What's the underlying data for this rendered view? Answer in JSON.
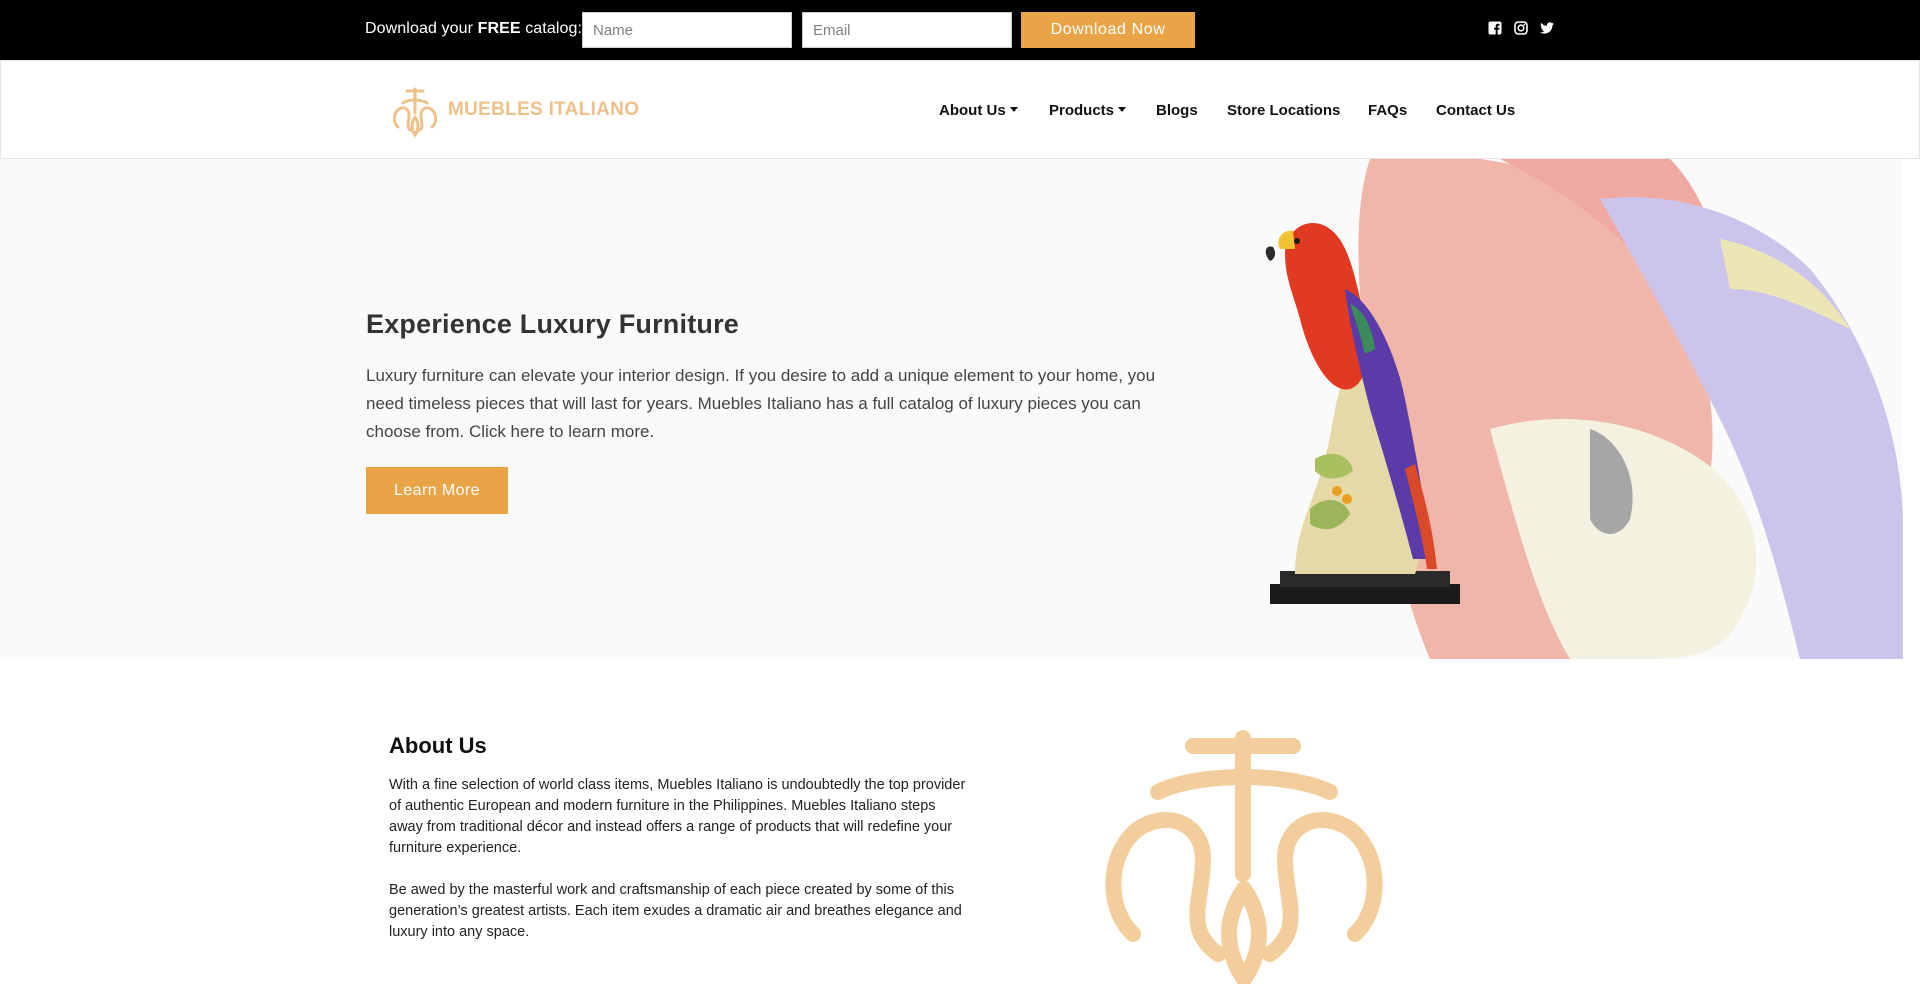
{
  "topbar": {
    "catalog_prefix": "Download your ",
    "catalog_free": "FREE",
    "catalog_suffix": " catalog:",
    "name_placeholder": "Name",
    "email_placeholder": "Email",
    "download_label": "Download Now",
    "social_icons": [
      "facebook-icon",
      "instagram-icon",
      "twitter-icon"
    ]
  },
  "header": {
    "logo_text": "MUEBLES ITALIANO",
    "nav": {
      "about": "About Us",
      "products": "Products",
      "blogs": "Blogs",
      "stores": "Store Locations",
      "faqs": "FAQs",
      "contact": "Contact Us"
    }
  },
  "hero": {
    "title": "Experience Luxury Furniture",
    "body": "Luxury furniture can elevate your interior design. If you desire to add a unique element to your home, you need timeless pieces that will last for years. Muebles Italiano has a full catalog of luxury pieces you can choose from. Click here to learn more.",
    "button": "Learn More"
  },
  "about": {
    "title": "About Us",
    "p1": "With a fine selection of world class items, Muebles Italiano is undoubtedly the top provider of authentic European and modern furniture in the Philippines. Muebles Italiano steps away from traditional décor and instead offers a range of products that will redefine your furniture experience.",
    "p2": "Be awed by the masterful work and craftsmanship of each piece created by some of this generation’s greatest artists. Each item exudes a dramatic air and breathes elegance and luxury into any space."
  },
  "colors": {
    "accent": "#e8a446",
    "logo_gold": "#eec08a",
    "topbar_bg": "#000000",
    "hero_bg": "#fafafa"
  }
}
